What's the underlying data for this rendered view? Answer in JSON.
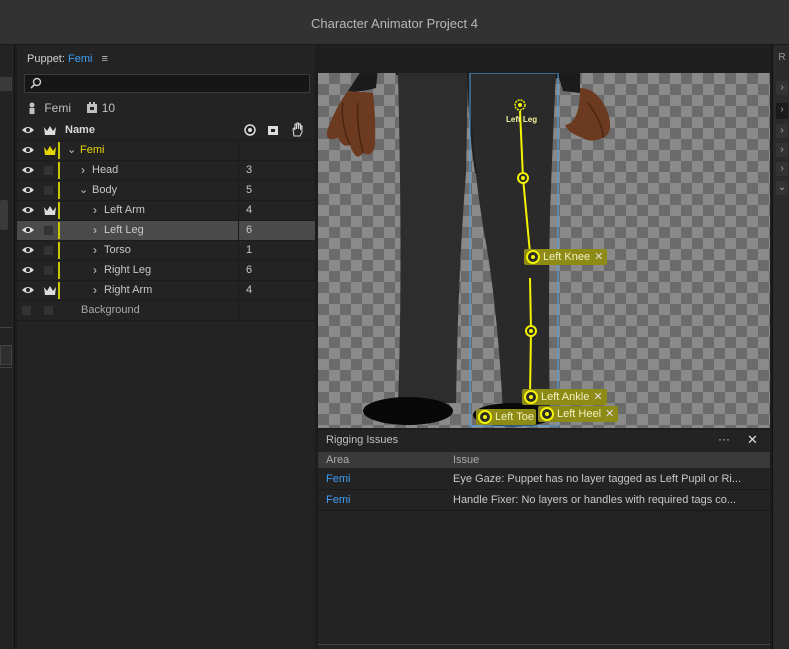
{
  "app": {
    "title": "Character Animator Project 4"
  },
  "puppet_panel": {
    "header_label": "Puppet:",
    "puppet_name": "Femi",
    "search": {
      "placeholder": ""
    },
    "meta": {
      "name": "Femi",
      "count": "10"
    },
    "columns": {
      "name": "Name"
    },
    "rows": [
      {
        "label": "Femi",
        "number": "",
        "level": 0,
        "expanded": true,
        "crown": true,
        "highlight": true
      },
      {
        "label": "Head",
        "number": "3",
        "level": 1,
        "expanded": false
      },
      {
        "label": "Body",
        "number": "5",
        "level": 1,
        "expanded": true
      },
      {
        "label": "Left Arm",
        "number": "4",
        "level": 2,
        "expanded": false,
        "crown": true
      },
      {
        "label": "Left Leg",
        "number": "6",
        "level": 2,
        "expanded": false,
        "selected": true
      },
      {
        "label": "Torso",
        "number": "1",
        "level": 2,
        "expanded": false
      },
      {
        "label": "Right Leg",
        "number": "6",
        "level": 2,
        "expanded": false
      },
      {
        "label": "Right Arm",
        "number": "4",
        "level": 2,
        "expanded": false,
        "crown": true
      },
      {
        "label": "Background",
        "number": "",
        "level": 0,
        "expanded": null,
        "dim": true
      }
    ]
  },
  "canvas": {
    "labels": {
      "left_leg": "Left Leg",
      "left_knee": "Left Knee",
      "left_ankle": "Left Ankle",
      "left_toe": "Left Toe",
      "left_heel": "Left Heel"
    },
    "colors": {
      "handle": "#f3f300",
      "tag_bg": "#8e8a16",
      "bounding_box": "#4ea3e6"
    }
  },
  "rigging_issues": {
    "title": "Rigging Issues",
    "more_label": "···",
    "close_label": "✕",
    "columns": {
      "area": "Area",
      "issue": "Issue"
    },
    "rows": [
      {
        "area": "Femi",
        "issue": "Eye Gaze: Puppet has no layer tagged as Left Pupil or Ri..."
      },
      {
        "area": "Femi",
        "issue": "Handle Fixer: No layers or handles with required tags co..."
      }
    ]
  },
  "accent_color": "#3d9ff5"
}
